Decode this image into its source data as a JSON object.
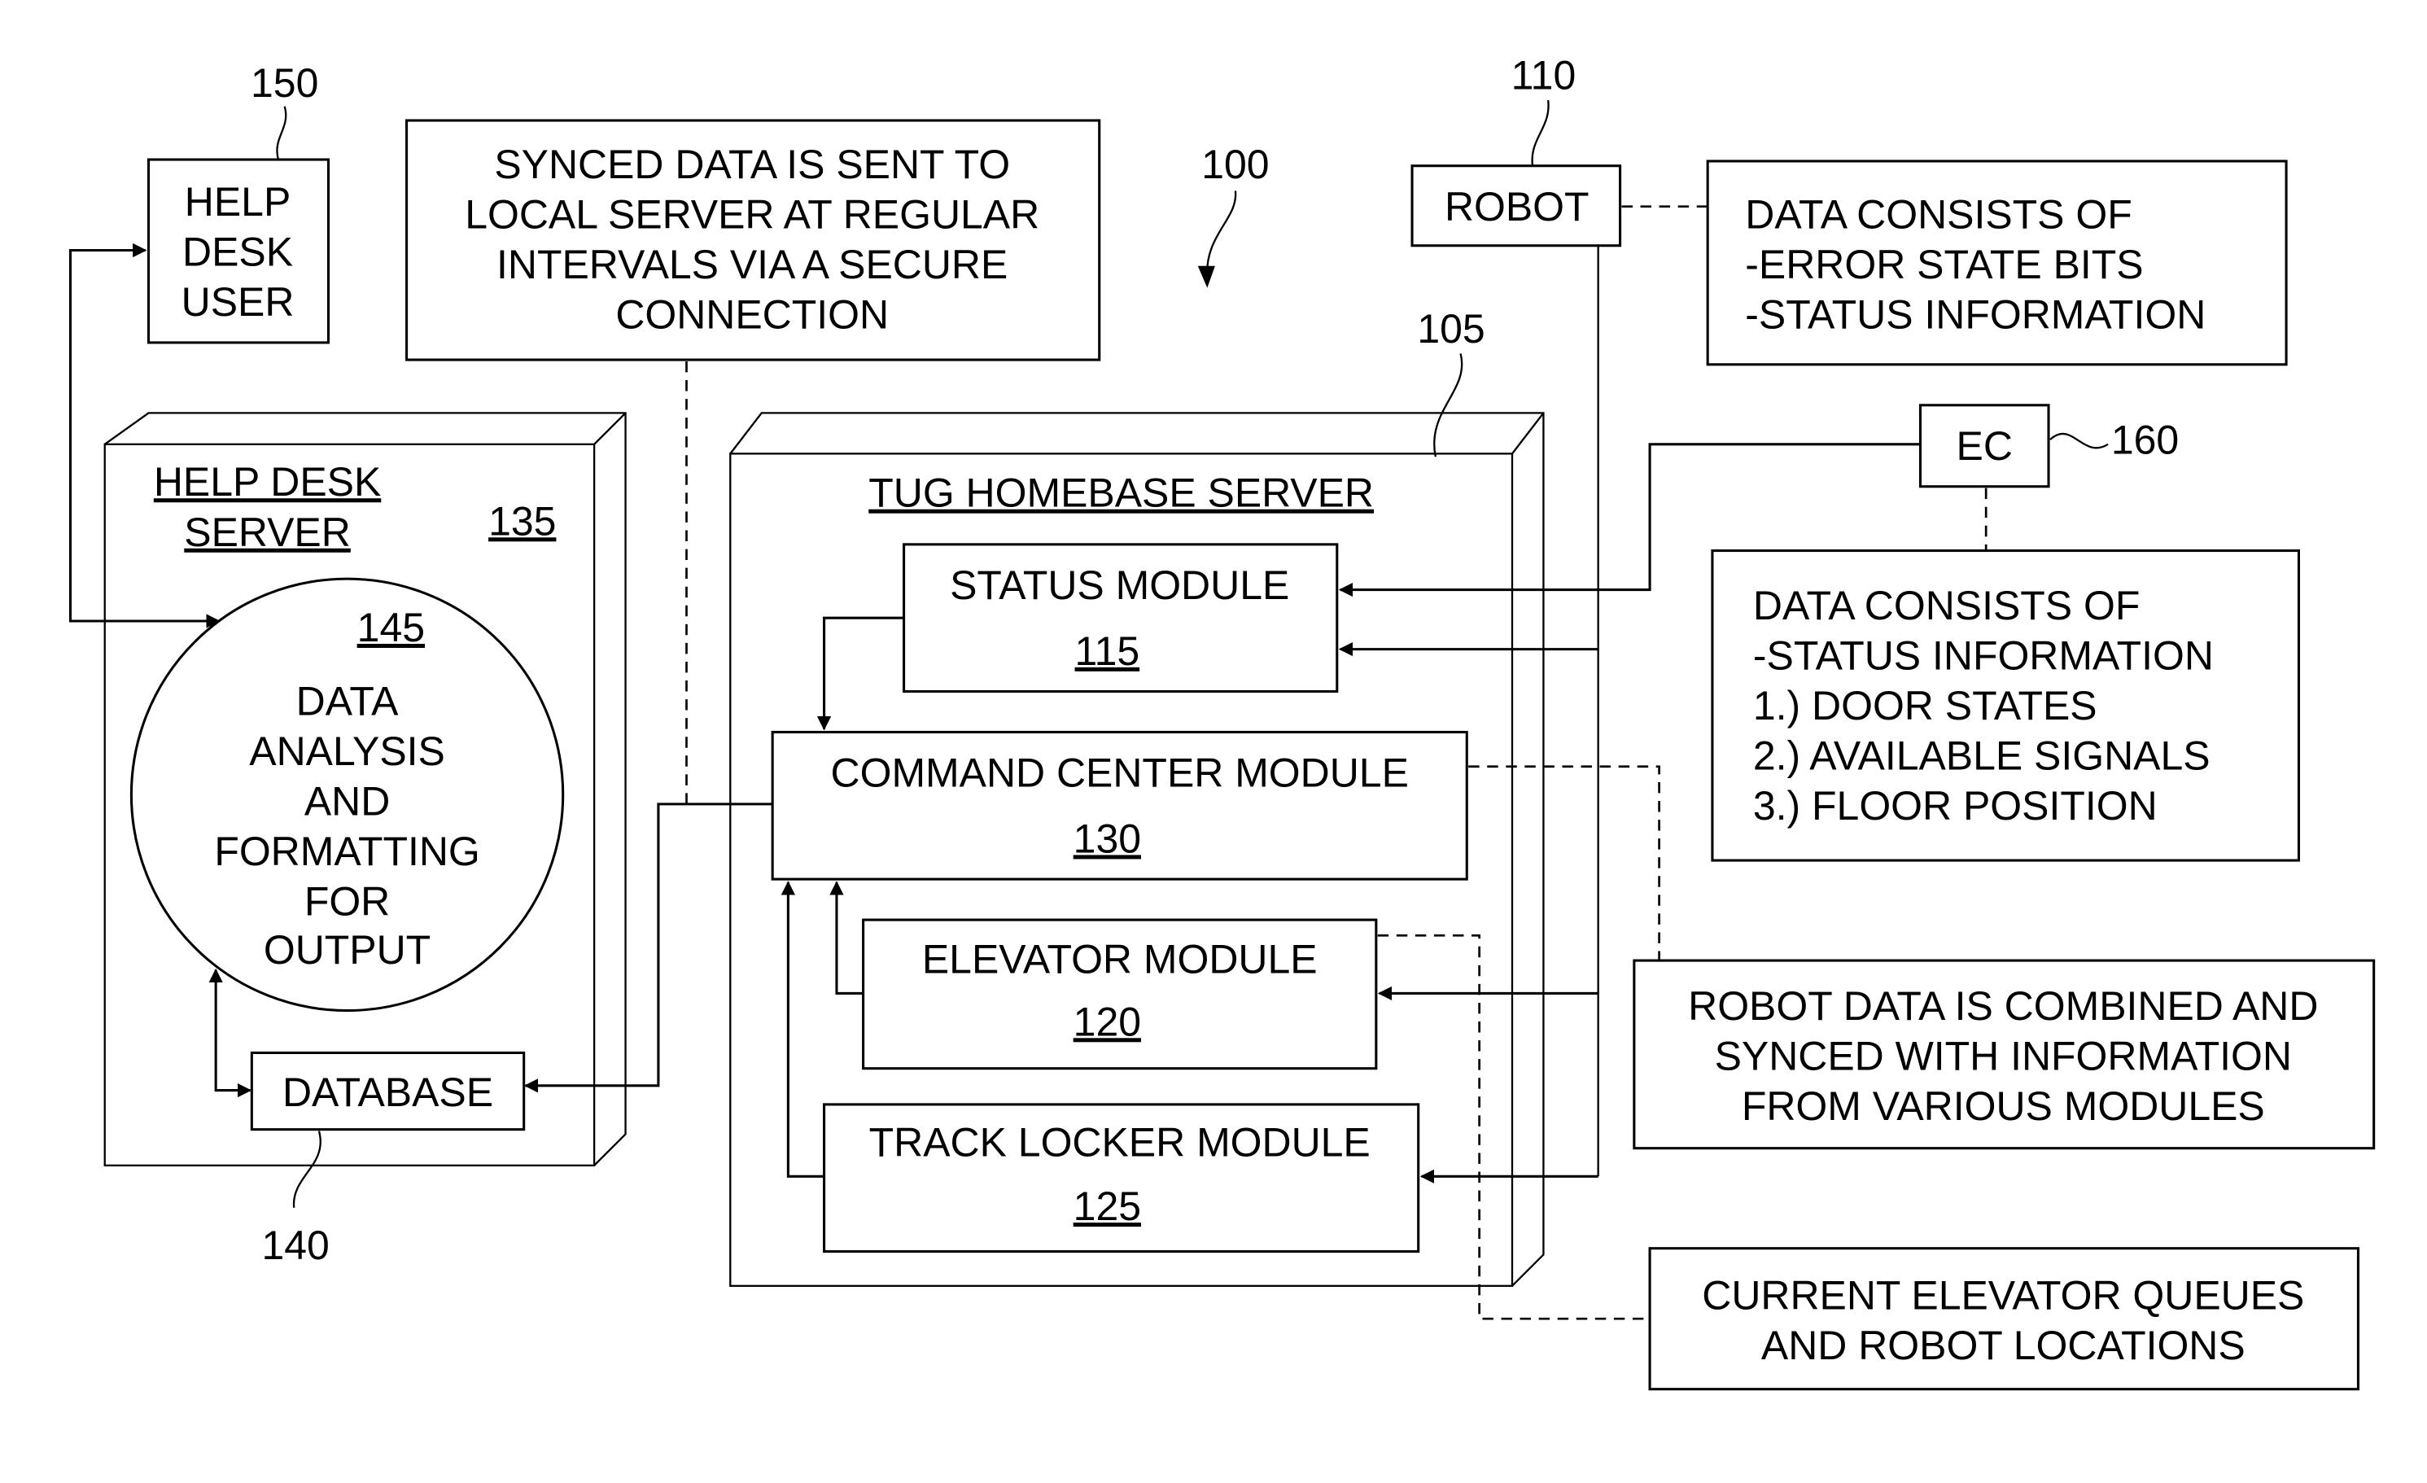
{
  "figure_ref": "100",
  "help_desk_user": {
    "ref": "150",
    "lines": [
      "HELP",
      "DESK",
      "USER"
    ]
  },
  "synced_note": {
    "lines": [
      "SYNCED DATA IS SENT TO",
      "LOCAL SERVER AT REGULAR",
      "INTERVALS VIA A SECURE",
      "CONNECTION"
    ]
  },
  "robot": {
    "ref": "110",
    "label": "ROBOT"
  },
  "robot_data_note": {
    "lines": [
      "DATA CONSISTS OF",
      "-ERROR STATE BITS",
      "-STATUS INFORMATION"
    ]
  },
  "help_desk_server": {
    "title_lines": [
      "HELP DESK",
      "SERVER"
    ],
    "ref": "135",
    "analysis": {
      "ref": "145",
      "lines": [
        "DATA",
        "ANALYSIS",
        "AND",
        "FORMATTING",
        "FOR",
        "OUTPUT"
      ]
    },
    "database": {
      "label": "DATABASE",
      "ref": "140"
    }
  },
  "tug_server": {
    "ref": "105",
    "title": "TUG HOMEBASE SERVER",
    "modules": {
      "status": {
        "label": "STATUS MODULE",
        "ref": "115"
      },
      "command_center": {
        "label": "COMMAND CENTER MODULE",
        "ref": "130"
      },
      "elevator": {
        "label": "ELEVATOR MODULE",
        "ref": "120"
      },
      "track_locker": {
        "label": "TRACK LOCKER MODULE",
        "ref": "125"
      }
    }
  },
  "ec": {
    "label": "EC",
    "ref": "160"
  },
  "ec_data_note": {
    "lines": [
      "DATA CONSISTS OF",
      "-STATUS INFORMATION",
      "1.) DOOR STATES",
      "2.) AVAILABLE SIGNALS",
      "3.) FLOOR POSITION"
    ]
  },
  "combined_note": {
    "lines": [
      "ROBOT DATA IS COMBINED AND",
      "SYNCED WITH INFORMATION",
      "FROM VARIOUS MODULES"
    ]
  },
  "queues_note": {
    "lines": [
      "CURRENT ELEVATOR QUEUES",
      "AND ROBOT LOCATIONS"
    ]
  }
}
